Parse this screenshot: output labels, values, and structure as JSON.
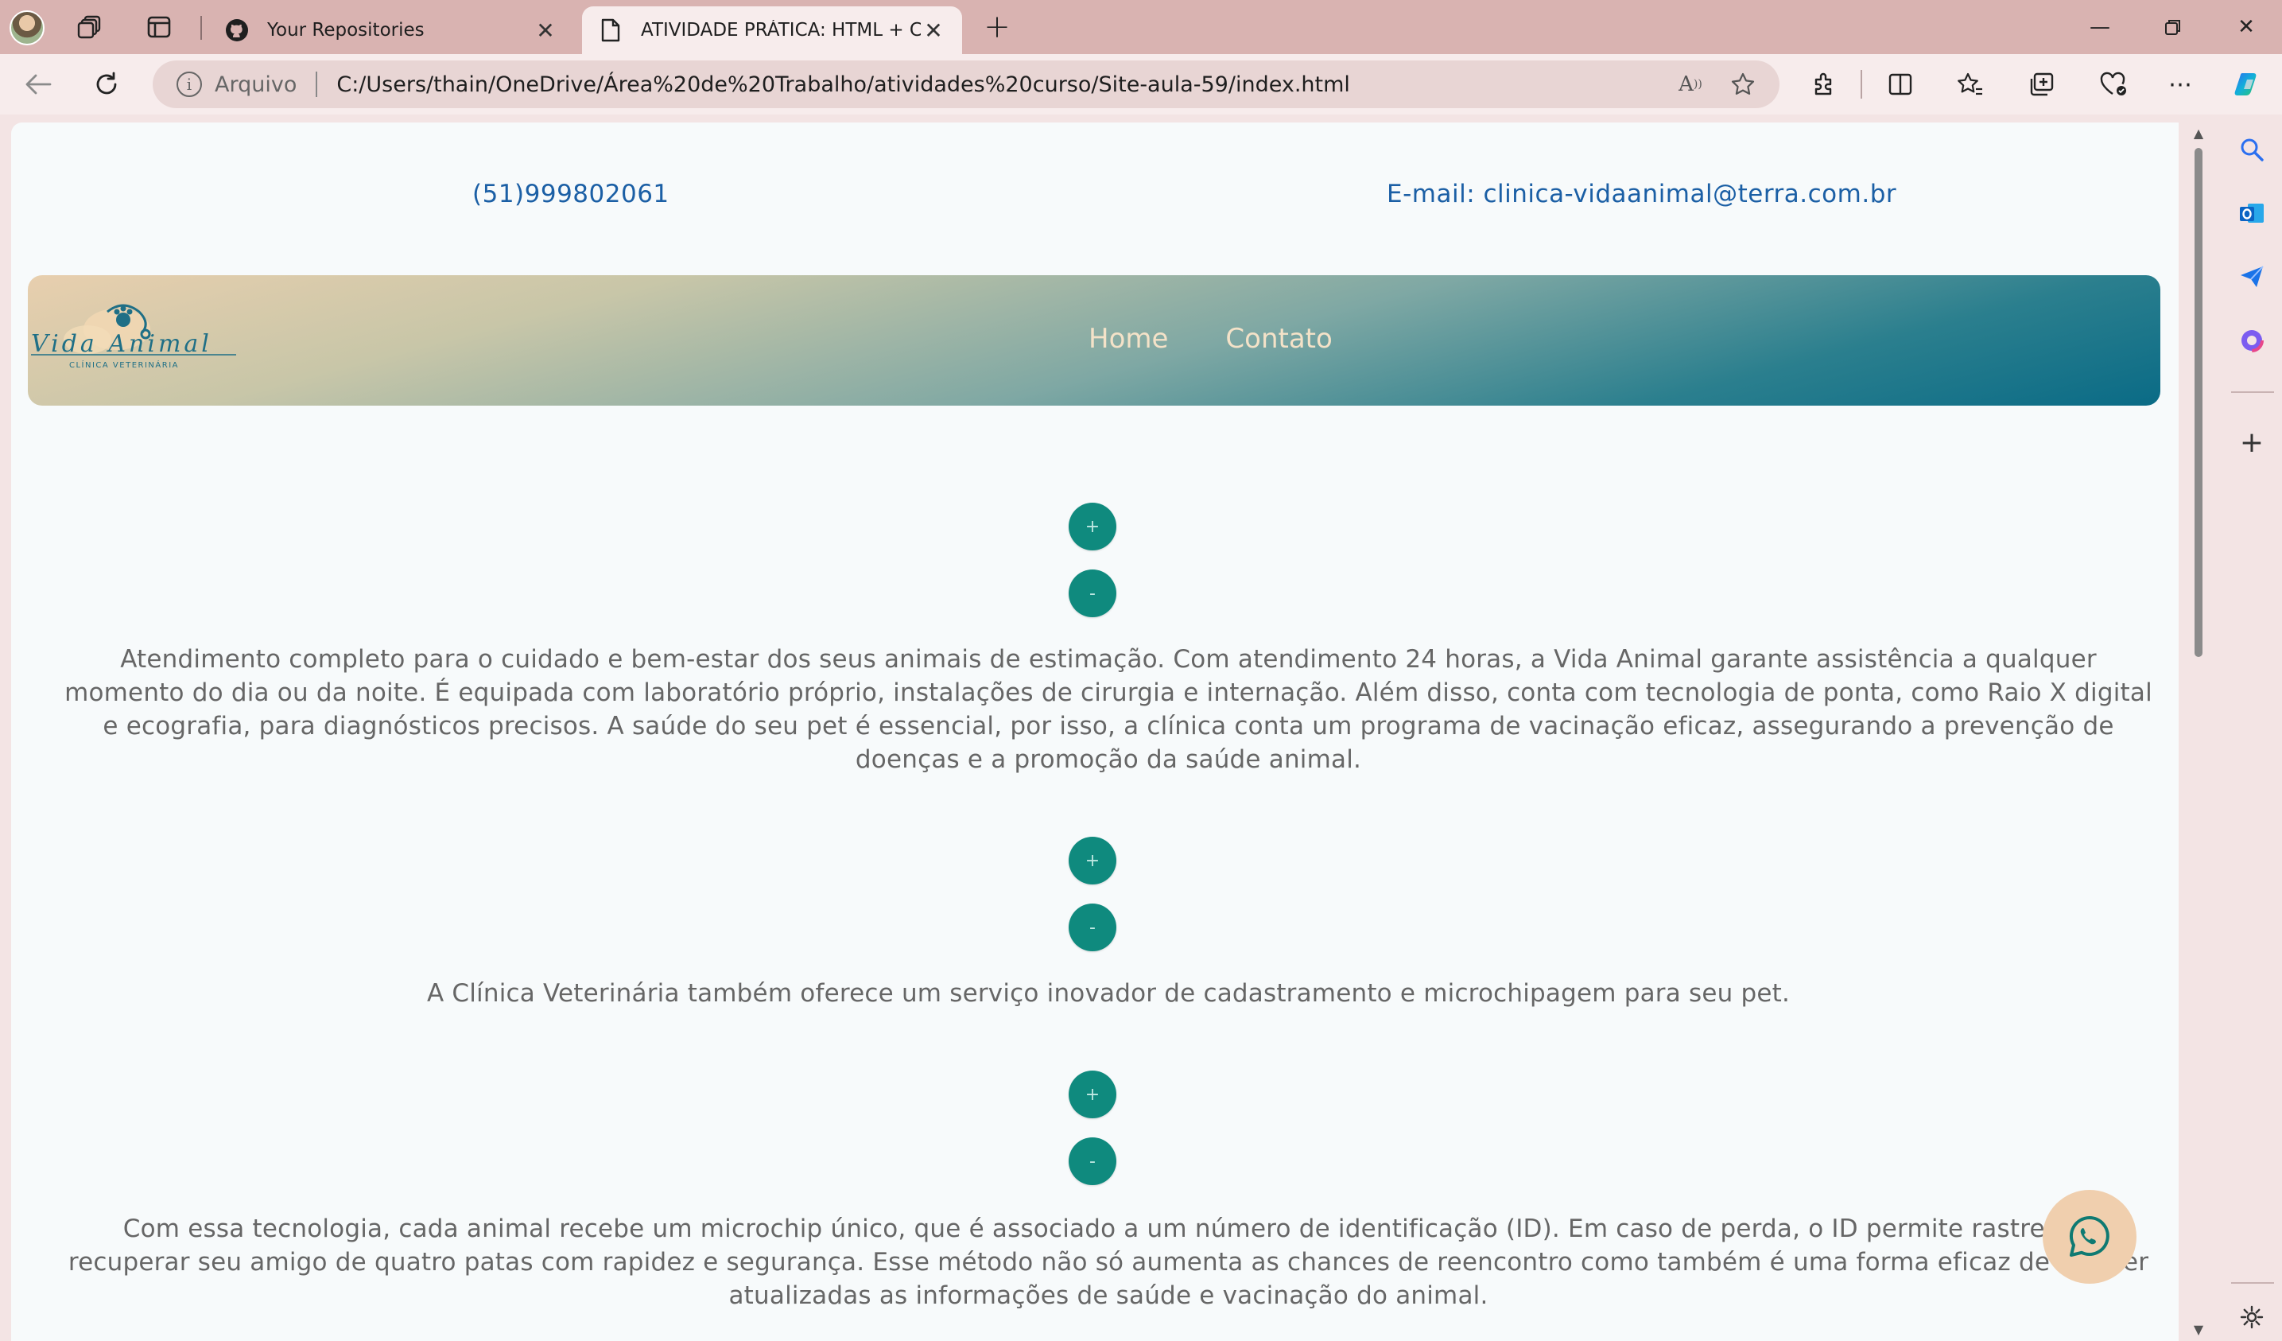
{
  "browser": {
    "tabs": [
      {
        "title": "Your Repositories",
        "favicon": "github-icon"
      },
      {
        "title": "ATIVIDADE PRÁTICA: HTML + CSS",
        "favicon": "document-icon"
      }
    ],
    "address": {
      "scheme_label": "Arquivo",
      "url": "C:/Users/thain/OneDrive/Área%20de%20Trabalho/atividades%20curso/Site-aula-59/index.html"
    }
  },
  "site": {
    "phone": "(51)999802061",
    "email": "E-mail: clinica-vidaanimal@terra.com.br",
    "logo": {
      "name": "Vida Animal",
      "subtitle": "CLÍNICA VETERINÁRIA"
    },
    "nav": [
      {
        "label": "Home"
      },
      {
        "label": "Contato"
      }
    ],
    "sections": [
      {
        "expand_label": "+",
        "collapse_label": "-",
        "text": "Atendimento completo para o cuidado e bem-estar dos seus animais de estimação. Com atendimento 24 horas, a Vida Animal garante assistência a qualquer momento do dia ou da noite. É equipada com laboratório próprio, instalações de cirurgia e internação. Além disso, conta com tecnologia de ponta, como Raio X digital e ecografia, para diagnósticos precisos. A saúde do seu pet é essencial, por isso, a clínica conta um programa de vacinação eficaz, assegurando a prevenção de doenças e a promoção da saúde animal."
      },
      {
        "expand_label": "+",
        "collapse_label": "-",
        "text": "A Clínica Veterinária também oferece um serviço inovador de cadastramento e microchipagem para seu pet."
      },
      {
        "expand_label": "+",
        "collapse_label": "-",
        "text": "Com essa tecnologia, cada animal recebe um microchip único, que é associado a um número de identificação (ID). Em caso de perda, o ID permite rastrear e recuperar seu amigo de quatro patas com rapidez e segurança. Esse método não só aumenta as chances de reencontro como também é uma forma eficaz de manter atualizadas as informações de saúde e vacinação do animal."
      }
    ],
    "whatsapp_icon": "whatsapp-icon"
  },
  "colors": {
    "tabbar": "#d9b3b1",
    "link_blue": "#1b5fa5",
    "nav_text": "#f4e2c8",
    "toggle_teal": "#0f8a7e",
    "whatsapp_bg": "#f0cfae"
  }
}
